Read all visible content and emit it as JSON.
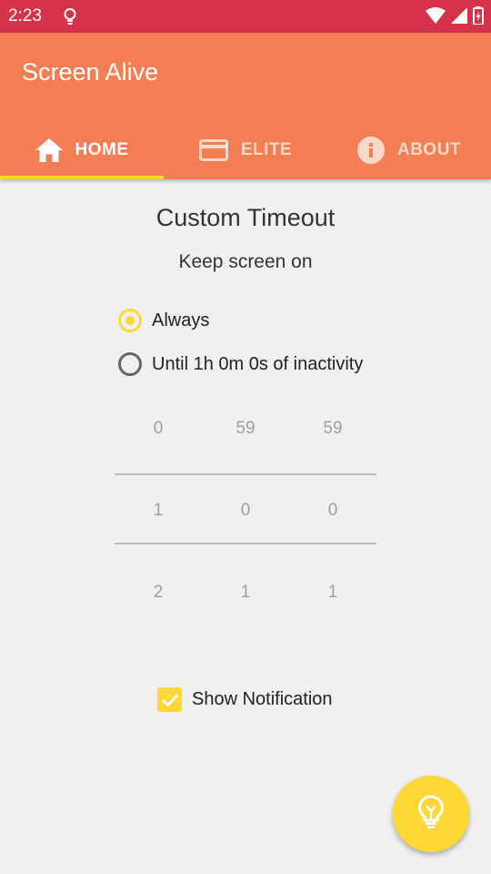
{
  "status_bar": {
    "time": "2:23"
  },
  "app": {
    "title": "Screen Alive"
  },
  "tabs": [
    {
      "label": "HOME",
      "icon": "home-icon",
      "active": true
    },
    {
      "label": "ELITE",
      "icon": "credit-card-icon",
      "active": false
    },
    {
      "label": "ABOUT",
      "icon": "info-icon",
      "active": false
    }
  ],
  "content": {
    "title": "Custom Timeout",
    "subtitle": "Keep screen on"
  },
  "options": [
    {
      "label": "Always",
      "selected": true
    },
    {
      "label": "Until 1h 0m 0s of inactivity",
      "selected": false
    }
  ],
  "picker": {
    "hours": [
      "0",
      "1",
      "2"
    ],
    "minutes": [
      "59",
      "0",
      "1"
    ],
    "seconds": [
      "59",
      "0",
      "1"
    ]
  },
  "notification": {
    "label": "Show Notification",
    "checked": true
  },
  "colors": {
    "status_bar": "#d6334a",
    "app_bar": "#f37e53",
    "accent": "#fdd835",
    "background": "#f0f0f0"
  }
}
